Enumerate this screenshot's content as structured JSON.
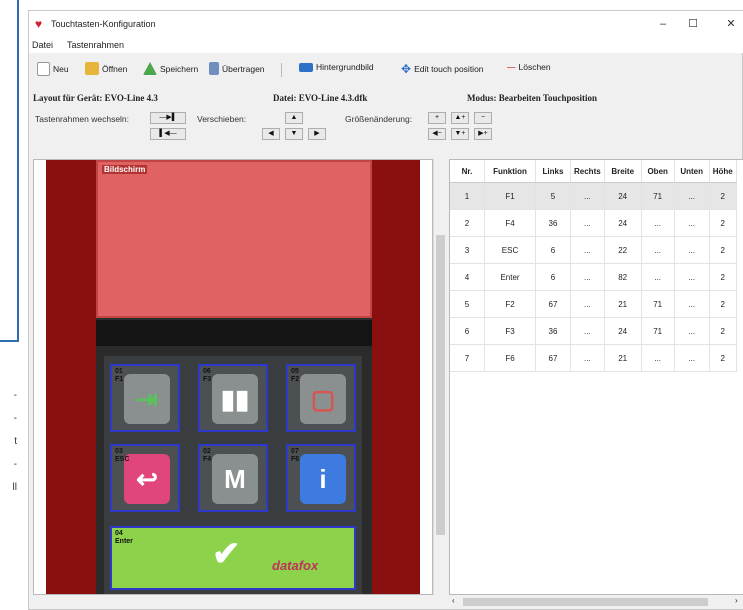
{
  "page_side": {
    "dashes": [
      "-",
      "-",
      "t",
      "-",
      "ll"
    ]
  },
  "window": {
    "title": "Touchtasten-Konfiguration",
    "buttons": [
      "–",
      "☐",
      "✕"
    ]
  },
  "menu": [
    "Datei",
    "Tastenrahmen"
  ],
  "toolbar": {
    "new": "Neu",
    "open": "Öffnen",
    "save": "Speichern",
    "transfer": "Übertragen",
    "background": "Hintergrundbild",
    "edit_touch": "Edit touch position",
    "delete": "Löschen"
  },
  "info": {
    "layout": "Layout für Gerät: EVO-Line 4.3",
    "file": "Datei: EVO-Line 4.3.dfk",
    "mode": "Modus: Bearbeiten Touchposition"
  },
  "controls": {
    "switch_label": "Tastenrahmen wechseln:",
    "move_label": "Verschieben:",
    "size_label": "Größenänderung:",
    "switch_next": "—▶▌",
    "switch_prev": "▌◀—",
    "up": "▲",
    "down": "▼",
    "left": "◀",
    "right": "▶",
    "grow": "+",
    "shrink": "−",
    "h_plus": "▲+",
    "h_minus": "▼+",
    "w_plus": "▶+",
    "w_minus": "◀−"
  },
  "device": {
    "screen_label": "Bildschirm",
    "keys": [
      {
        "label": "01\nF1",
        "symbol": "⇥",
        "color": "#8a8f90",
        "accent": "#5ac25a"
      },
      {
        "label": "06\nF3",
        "symbol": "▮▮",
        "color": "#8a8f90",
        "accent": "#ffffff"
      },
      {
        "label": "05\nF2",
        "symbol": "▢",
        "color": "#8a8f90",
        "accent": "#d9534f"
      },
      {
        "label": "03\nESC",
        "symbol": "↩",
        "color": "#e0457b",
        "accent": "#ffffff"
      },
      {
        "label": "02\nF4",
        "symbol": "M",
        "color": "#8a8f90",
        "accent": "#ffffff"
      },
      {
        "label": "07\nF6",
        "symbol": "i",
        "color": "#3d7be0",
        "accent": "#ffffff"
      }
    ],
    "enter_label": "04\nEnter",
    "enter_symbol": "✔",
    "brand": "datafox"
  },
  "table": {
    "columns": [
      "Nr.",
      "Funktion",
      "Links",
      "Rechts",
      "Breite",
      "Oben",
      "Unten",
      "Höhe"
    ],
    "rows": [
      [
        "1",
        "F1",
        "5",
        "...",
        "24",
        "71",
        "...",
        "2"
      ],
      [
        "2",
        "F4",
        "36",
        "...",
        "24",
        "...",
        "...",
        "2"
      ],
      [
        "3",
        "ESC",
        "6",
        "...",
        "22",
        "...",
        "...",
        "2"
      ],
      [
        "4",
        "Enter",
        "6",
        "...",
        "82",
        "...",
        "...",
        "2"
      ],
      [
        "5",
        "F2",
        "67",
        "...",
        "21",
        "71",
        "...",
        "2"
      ],
      [
        "6",
        "F3",
        "36",
        "...",
        "24",
        "71",
        "...",
        "2"
      ],
      [
        "7",
        "F6",
        "67",
        "...",
        "21",
        "...",
        "...",
        "2"
      ]
    ]
  }
}
